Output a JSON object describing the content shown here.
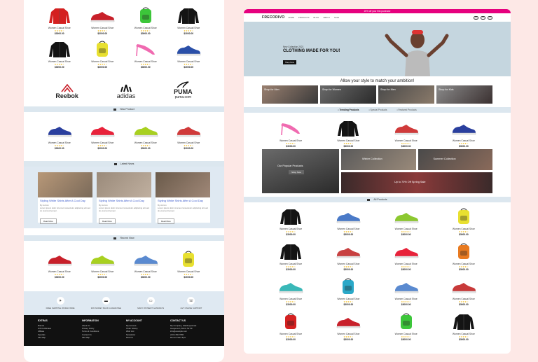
{
  "product": {
    "name": "Women Casual Shoe",
    "stars": "★★★★☆",
    "price": "$3000.00"
  },
  "left": {
    "row1": [
      {
        "icon": "red-jacket-icon",
        "color": "#d42020",
        "kind": "jacket"
      },
      {
        "icon": "red-sneaker-icon",
        "color": "#c8202a",
        "kind": "shoe"
      },
      {
        "icon": "green-backpack-icon",
        "color": "#3cc63a",
        "kind": "bag"
      },
      {
        "icon": "black-jacket-icon",
        "color": "#141414",
        "kind": "jacket"
      }
    ],
    "row2": [
      {
        "icon": "black-jacket-icon",
        "color": "#141414",
        "kind": "jacket"
      },
      {
        "icon": "yellow-backpack-icon",
        "color": "#e8e030",
        "kind": "bag"
      },
      {
        "icon": "pink-heels-icon",
        "color": "#f06ab0",
        "kind": "heel"
      },
      {
        "icon": "blue-sneaker-icon",
        "color": "#2a4fa8",
        "kind": "shoe"
      }
    ],
    "brands": [
      {
        "name": "Reebok",
        "icon": "reebok-logo"
      },
      {
        "name": "adidas",
        "icon": "adidas-logo"
      },
      {
        "name": "PUMA",
        "sub": "puma.com",
        "icon": "puma-logo"
      }
    ],
    "new_products_label": "New Product",
    "new_products": [
      {
        "icon": "blue-sneaker-icon",
        "color": "#2a3f9e",
        "kind": "shoe"
      },
      {
        "icon": "red-sneaker-icon",
        "color": "#e8223a",
        "kind": "shoe"
      },
      {
        "icon": "lime-sneaker-icon",
        "color": "#a8d020",
        "kind": "shoe"
      },
      {
        "icon": "multicolor-sneaker-icon",
        "color": "#d03a3a",
        "kind": "shoe"
      }
    ],
    "news_label": "Latest News",
    "blogs": [
      {
        "title": "Styling White Shirts After A Cool Day",
        "meta": "By Admin",
        "desc": "Lorem ipsum dolor sit amet consectetur adipiscing elit sed do eiusmod tempor.",
        "btn": "Read More"
      },
      {
        "title": "Styling White Shirts After A Cool Day",
        "meta": "By Admin",
        "desc": "Lorem ipsum dolor sit amet consectetur adipiscing elit sed do eiusmod tempor.",
        "btn": "Read More"
      },
      {
        "title": "Styling White Shirts After A Cool Day",
        "meta": "By Admin",
        "desc": "Lorem ipsum dolor sit amet consectetur adipiscing elit sed do eiusmod tempor.",
        "btn": "Read More"
      }
    ],
    "recent_label": "Recent View",
    "recent": [
      {
        "icon": "red-sneaker-icon",
        "color": "#c8202a",
        "kind": "shoe"
      },
      {
        "icon": "lime-sneaker-icon",
        "color": "#a8d020",
        "kind": "shoe"
      },
      {
        "icon": "blue-sneaker-icon",
        "color": "#5a8ad0",
        "kind": "shoe"
      },
      {
        "icon": "yellow-backpack-icon",
        "color": "#e8e030",
        "kind": "bag"
      }
    ],
    "features": [
      {
        "icon": "truck-icon",
        "glyph": "✈",
        "text": "FREE SHIPPING WORLD WIDE"
      },
      {
        "icon": "money-back-icon",
        "glyph": "▬",
        "text": "30% MONEY BACK GUARANTEE"
      },
      {
        "icon": "card-icon",
        "glyph": "▭",
        "text": "MANY PAYMENT GATEWAYS"
      },
      {
        "icon": "support-icon",
        "glyph": "☏",
        "text": "24/7 ONLINE SUPPORT"
      }
    ],
    "footer": [
      {
        "head": "EXTRAS",
        "links": [
          "Brands",
          "Gift Certificates",
          "Affiliate",
          "Specials",
          "Site Map"
        ]
      },
      {
        "head": "INFORMATION",
        "links": [
          "About Us",
          "Privacy Policy",
          "Terms & Conditions",
          "Contact Us",
          "Site Map"
        ]
      },
      {
        "head": "MY ACCOUNT",
        "links": [
          "My Account",
          "Order History",
          "Wish List",
          "Newsletter",
          "Returns"
        ]
      },
      {
        "head": "CONTACT US",
        "links": [
          "My Company, Glasthuysstraat",
          "Hoogeveen, Bohm Str 59",
          "info@example.com",
          "(123) 456-7890",
          "Mon-Fri 9am-6pm"
        ]
      }
    ]
  },
  "right": {
    "topbar": "20% off your first purchase",
    "logo": "FRECODIVO",
    "nav": [
      "HOME",
      "PRODUCTS",
      "BLOG",
      "ABOUT",
      "SALE"
    ],
    "hero_small": "New Collection 2021",
    "hero_big": "CLOTHING MADE FOR YOU!",
    "hero_btn": "Shop Now",
    "tagline": "Allow your style to match your ambition!",
    "categories": [
      "Shop for Men",
      "Shop for Women",
      "Shop for Men",
      "Shop for Kids"
    ],
    "tabs": [
      "Trending Products",
      "Special Products",
      "Featured Products"
    ],
    "trending": [
      {
        "icon": "pink-heels-icon",
        "color": "#f06ab0",
        "kind": "heel"
      },
      {
        "icon": "black-jacket-icon",
        "color": "#141414",
        "kind": "jacket"
      },
      {
        "icon": "multicolor-sneaker-icon",
        "color": "#d03a3a",
        "kind": "shoe"
      },
      {
        "icon": "blue-sneaker-icon",
        "color": "#2a3f9e",
        "kind": "shoe"
      }
    ],
    "promo": {
      "popular": "Our Popular Products",
      "popular_btn": "Shop Now",
      "winter": "Winter Collection",
      "summer": "Summer Collection",
      "sale": "Up to 70% Off Spring Sale"
    },
    "all_label": "All Products",
    "all_products": [
      {
        "icon": "black-jacket-icon",
        "color": "#141414",
        "kind": "jacket"
      },
      {
        "icon": "blue-sneaker-icon",
        "color": "#4a7ac8",
        "kind": "shoe"
      },
      {
        "icon": "lime-sneaker-icon",
        "color": "#8cc830",
        "kind": "shoe"
      },
      {
        "icon": "yellow-backpack-icon",
        "color": "#e8e030",
        "kind": "bag"
      },
      {
        "icon": "black-jacket-icon",
        "color": "#141414",
        "kind": "jacket"
      },
      {
        "icon": "multicolor-sneaker-icon",
        "color": "#c84040",
        "kind": "shoe"
      },
      {
        "icon": "red-sneaker-icon",
        "color": "#e8223a",
        "kind": "shoe"
      },
      {
        "icon": "orange-backpack-icon",
        "color": "#e87a20",
        "kind": "bag"
      },
      {
        "icon": "teal-sneaker-icon",
        "color": "#3ab8b8",
        "kind": "shoe"
      },
      {
        "icon": "teal-backpack-icon",
        "color": "#2aa8c8",
        "kind": "bag"
      },
      {
        "icon": "blue-sneaker-icon",
        "color": "#5a8ad0",
        "kind": "shoe"
      },
      {
        "icon": "multicolor-sneaker-icon",
        "color": "#c83a3a",
        "kind": "shoe"
      },
      {
        "icon": "red-backpack-icon",
        "color": "#d42020",
        "kind": "bag"
      },
      {
        "icon": "red-sneaker-icon",
        "color": "#c8202a",
        "kind": "shoe"
      },
      {
        "icon": "green-backpack-icon",
        "color": "#3cc63a",
        "kind": "bag"
      },
      {
        "icon": "black-jacket-icon",
        "color": "#141414",
        "kind": "jacket"
      }
    ]
  }
}
